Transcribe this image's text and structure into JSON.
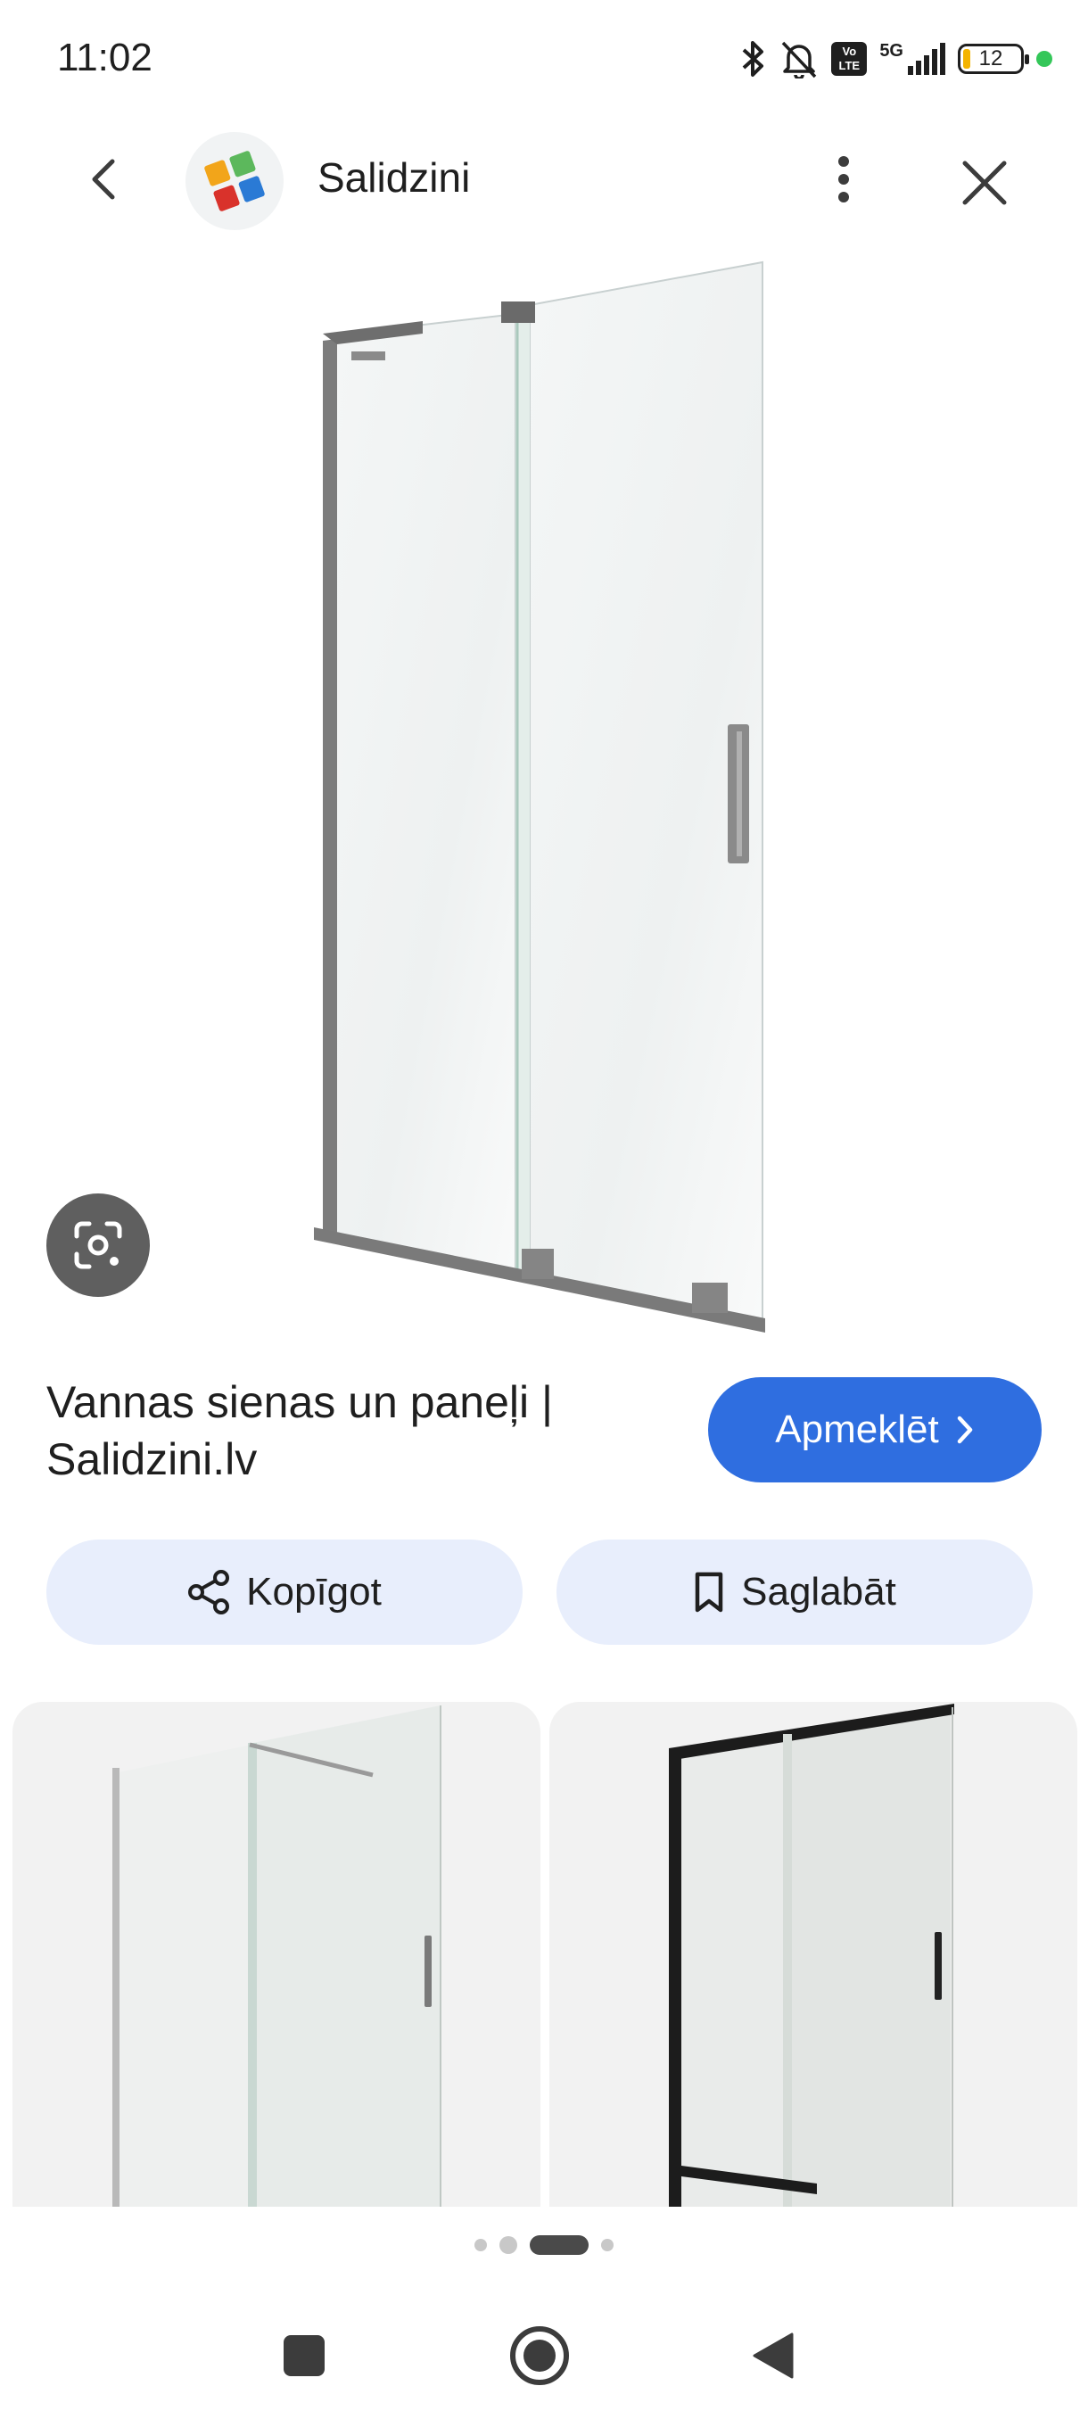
{
  "status_bar": {
    "time": "11:02",
    "battery_level": "12",
    "network": "5G",
    "volte": "Vo LTE",
    "icons": [
      "bluetooth-icon",
      "bell-off-icon",
      "volte-icon",
      "signal-icon",
      "battery-icon",
      "privacy-dot-icon"
    ]
  },
  "header": {
    "site_name": "Salidzini",
    "icons": [
      "back-icon",
      "site-logo-icon",
      "more-vertical-icon",
      "close-icon"
    ]
  },
  "main_image": {
    "subject": "glass shower screen",
    "lens_icon": "google-lens-icon"
  },
  "result": {
    "title": "Vannas sienas un paneļi | Salidzini.lv",
    "visit_label": "Apmeklēt"
  },
  "actions": {
    "share_label": "Kopīgot",
    "save_label": "Saglabāt"
  },
  "pagination": {
    "total": 4,
    "active_index": 2
  },
  "colors": {
    "accent": "#2f6ee0",
    "pill_bg": "#e8eefc",
    "lens_bg": "#5f5f5f",
    "battery_low": "#f4b400",
    "privacy_dot": "#34c759"
  }
}
